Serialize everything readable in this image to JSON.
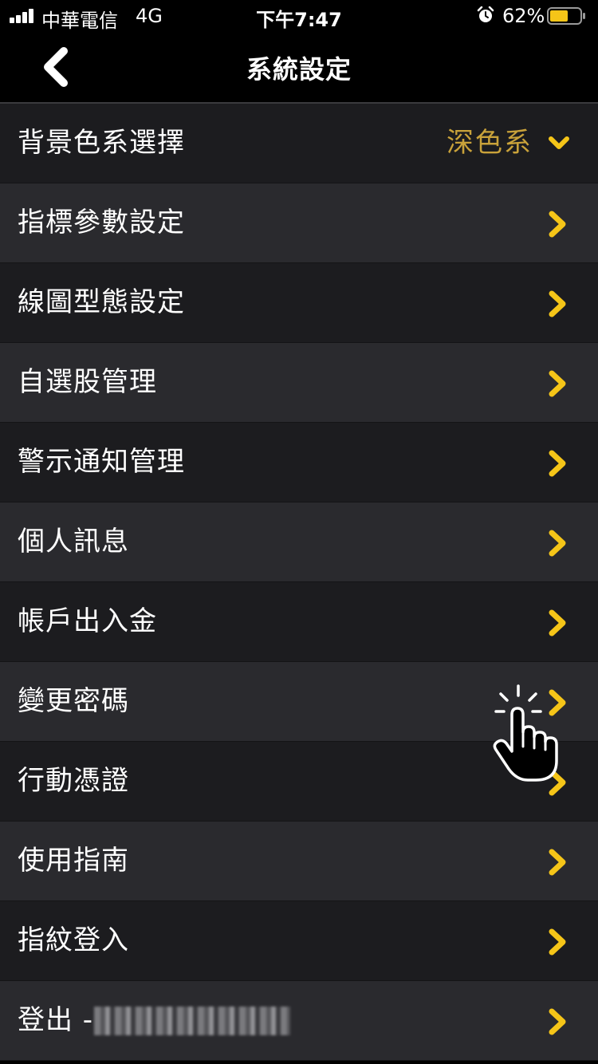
{
  "status_bar": {
    "carrier": "中華電信",
    "network": "4G",
    "time": "下午7:47",
    "battery_percent": "62%",
    "alarm_icon": "alarm-clock-icon",
    "battery_level": 0.62
  },
  "header": {
    "title": "系統設定",
    "back_icon": "chevron-left-icon"
  },
  "settings": {
    "theme": {
      "label": "背景色系選擇",
      "value": "深色系"
    },
    "items": [
      {
        "label": "指標參數設定"
      },
      {
        "label": "線圖型態設定"
      },
      {
        "label": "自選股管理"
      },
      {
        "label": "警示通知管理"
      },
      {
        "label": "個人訊息"
      },
      {
        "label": "帳戶出入金"
      },
      {
        "label": "變更密碼"
      },
      {
        "label": "行動憑證"
      },
      {
        "label": "使用指南"
      },
      {
        "label": "指紋登入"
      }
    ],
    "logout": {
      "label": "登出 -"
    }
  },
  "colors": {
    "background": "#000000",
    "row_dark": "#1c1c1f",
    "row_light": "#2a2a2e",
    "accent_yellow": "#f5c518",
    "value_gold": "#c9a23a"
  }
}
